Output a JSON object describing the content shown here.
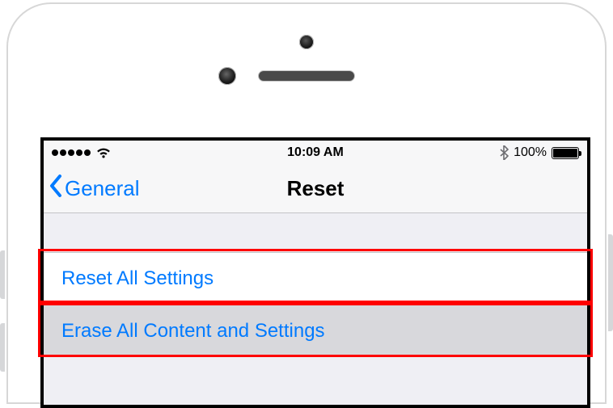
{
  "status_bar": {
    "time": "10:09 AM",
    "battery_pct": "100%"
  },
  "nav": {
    "back_label": "General",
    "title": "Reset"
  },
  "cells": {
    "reset_all": "Reset All Settings",
    "erase_all": "Erase All Content and Settings"
  },
  "colors": {
    "ios_blue": "#007aff",
    "annotation_red": "#ff0000"
  }
}
